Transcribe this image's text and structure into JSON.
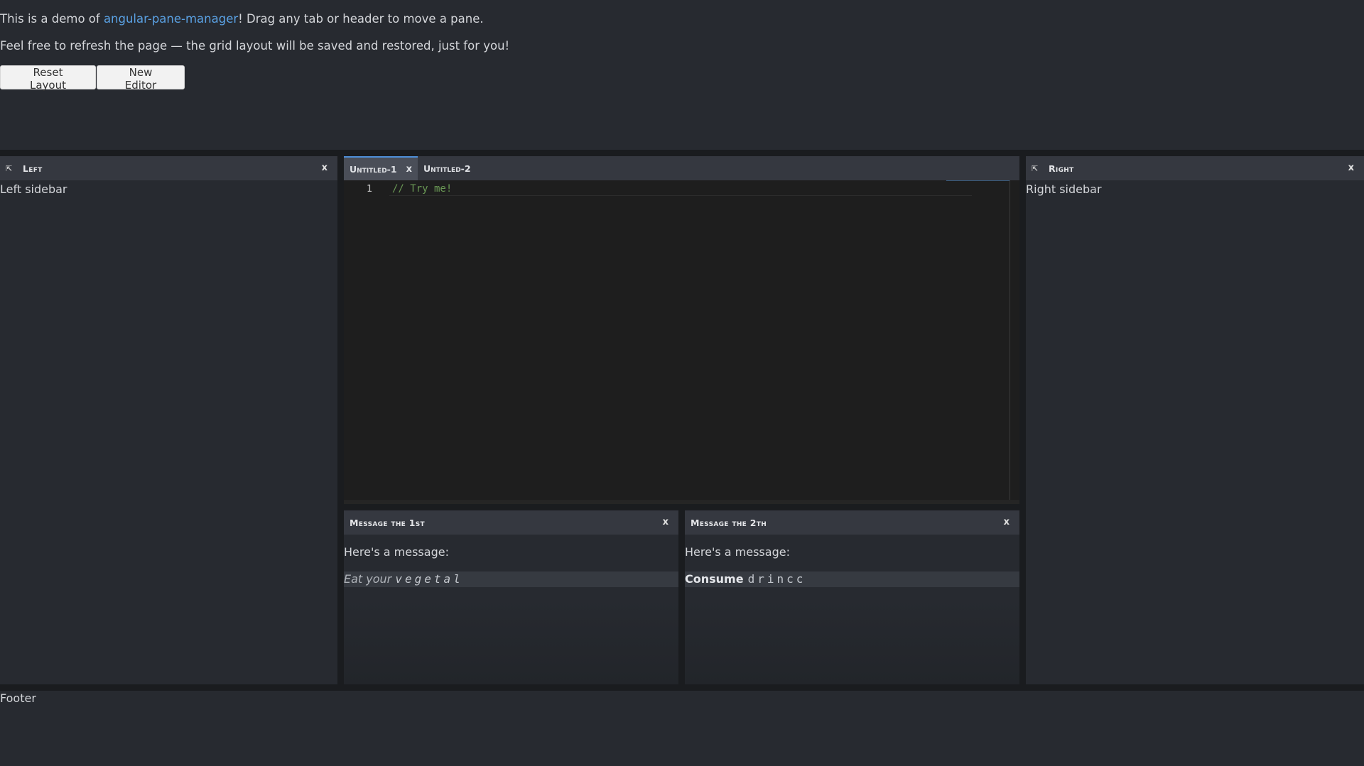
{
  "intro": {
    "line1_prefix": "This is a demo of ",
    "line1_link": "angular-pane-manager",
    "line1_suffix": "! Drag any tab or header to move a pane.",
    "line2": "Feel free to refresh the page — the grid layout will be saved and restored, just for you!"
  },
  "buttons": {
    "reset": "Reset Layout",
    "new_editor": "New Editor"
  },
  "left_pane": {
    "pin_icon": "⇱",
    "title": "Left",
    "close": "x",
    "body": "Left sidebar"
  },
  "right_pane": {
    "pin_icon": "⇱",
    "title": "Right",
    "close": "x",
    "body": "Right sidebar"
  },
  "editor_tabs": [
    {
      "label": "Untitled-1",
      "active": true,
      "close": "x"
    },
    {
      "label": "Untitled-2",
      "active": false
    }
  ],
  "editor": {
    "line_number": "1",
    "code": "// Try me!"
  },
  "message1": {
    "title": "Message the 1st",
    "close": "x",
    "label": "Here's a message:",
    "italic_part": "Eat your",
    "spaced_part": "vegetal"
  },
  "message2": {
    "title": "Message the 2th",
    "close": "x",
    "label": "Here's a message:",
    "bold_part": "Consume",
    "spaced_part": "drincc"
  },
  "footer": "Footer",
  "colors": {
    "background": "#272a30",
    "header": "#353840",
    "accent": "#4f8fd8",
    "link": "#5aa1e3",
    "editor_bg": "#1e1e1e",
    "comment": "#6a9955"
  }
}
